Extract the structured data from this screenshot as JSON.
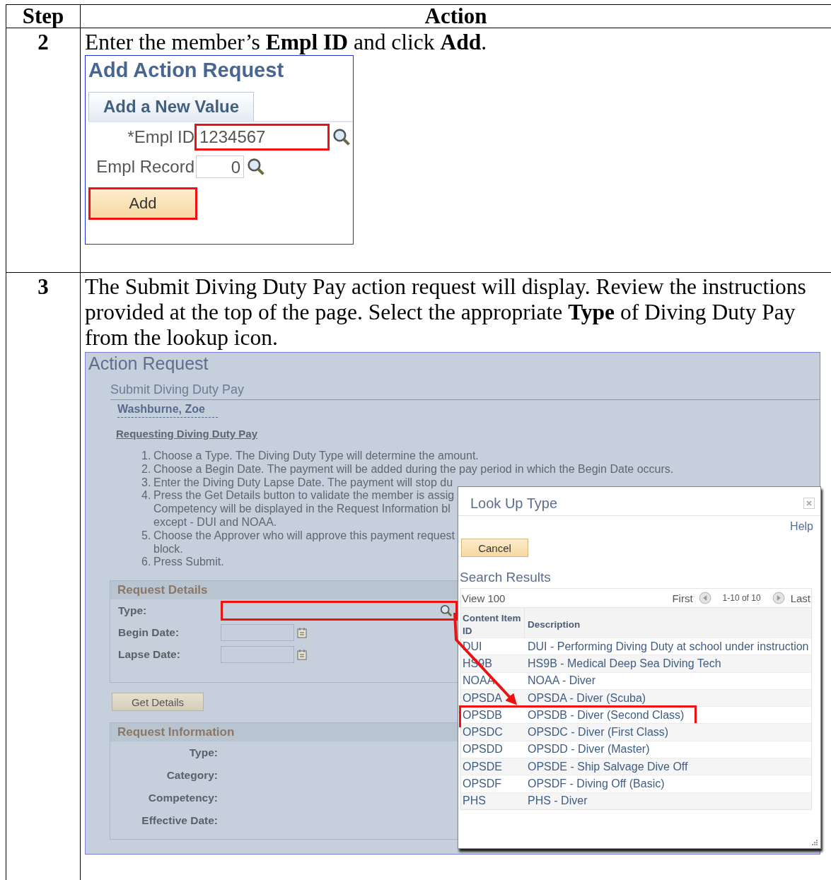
{
  "table": {
    "columns": [
      "Step",
      "Action"
    ],
    "rows": [
      {
        "step": "2",
        "instruction": "Enter the member’s **Empl ID** and click **Add**.",
        "add_action_request": {
          "title": "Add Action Request",
          "tabs": [
            {
              "label": "Add a New Value",
              "selected": true
            }
          ],
          "fields": [
            {
              "label": "*Empl ID",
              "value": "1234567",
              "highlighted": true
            },
            {
              "label": "Empl Record",
              "value": "0",
              "highlighted": false
            }
          ],
          "add_button": {
            "label": "Add",
            "highlighted": true
          }
        }
      },
      {
        "step": "3",
        "instruction": "The Submit Diving Duty Pay action request will display. Review the instructions provided at the top of the page. Select the appropriate **Type** of Diving Duty Pay from the lookup icon.",
        "action_request": {
          "title": "Action Request",
          "subtitle": "Submit Diving Duty Pay",
          "employee": "Washburne, Zoe",
          "section_link": "Requesting Diving Duty Pay",
          "instructions": [
            {
              "number": "1.",
              "lines": [
                "Choose a Type. The Diving Duty Type will determine the amount."
              ]
            },
            {
              "number": "2.",
              "lines": [
                "Choose a Begin Date. The payment will be added during the pay period in which the Begin Date occurs."
              ]
            },
            {
              "number": "3.",
              "lines": [
                "Enter the Diving Duty Lapse Date. The payment will stop du"
              ]
            },
            {
              "number": "4.",
              "lines": [
                "Press the Get Details button to validate the member is assig",
                "Competency will be displayed in the Request Information bl",
                "except - DUI and NOAA."
              ]
            },
            {
              "number": "5.",
              "lines": [
                "Choose the Approver who will approve this payment request",
                "block."
              ]
            },
            {
              "number": "6.",
              "lines": [
                "Press Submit."
              ]
            }
          ],
          "request_details": {
            "title": "Request Details",
            "type_label": "Type:",
            "type_highlighted": true,
            "begin_date_label": "Begin Date:",
            "lapse_date_label": "Lapse Date:"
          },
          "get_details_button": "Get Details",
          "request_information": {
            "title": "Request Information",
            "labels": [
              "Type:",
              "Category:",
              "Competency:",
              "Effective Date:"
            ]
          },
          "lookup_dialog": {
            "title": "Look Up Type",
            "help": "Help",
            "cancel": "Cancel",
            "results_title": "Search Results",
            "view_all": "View 100",
            "first": "First",
            "range": "1-10 of 10",
            "last": "Last",
            "columns": [
              "Content Item ID",
              "Description"
            ],
            "rows": [
              {
                "id": "DUI",
                "description": "DUI - Performing Diving Duty at school under instruction",
                "highlighted": false
              },
              {
                "id": "HS9B",
                "description": "HS9B - Medical Deep Sea Diving Tech",
                "highlighted": false
              },
              {
                "id": "NOAA",
                "description": "NOAA - Diver",
                "highlighted": false
              },
              {
                "id": "OPSDA",
                "description": "OPSDA - Diver (Scuba)",
                "highlighted": false
              },
              {
                "id": "OPSDB",
                "description": "OPSDB - Diver (Second Class)",
                "highlighted": true
              },
              {
                "id": "OPSDC",
                "description": "OPSDC - Diver (First Class)",
                "highlighted": false
              },
              {
                "id": "OPSDD",
                "description": "OPSDD - Diver (Master)",
                "highlighted": false
              },
              {
                "id": "OPSDE",
                "description": "OPSDE - Ship Salvage Dive Off",
                "highlighted": false
              },
              {
                "id": "OPSDF",
                "description": "OPSDF - Diving Off (Basic)",
                "highlighted": false
              },
              {
                "id": "PHS",
                "description": "PHS - Diver",
                "highlighted": false
              }
            ]
          }
        }
      }
    ]
  }
}
